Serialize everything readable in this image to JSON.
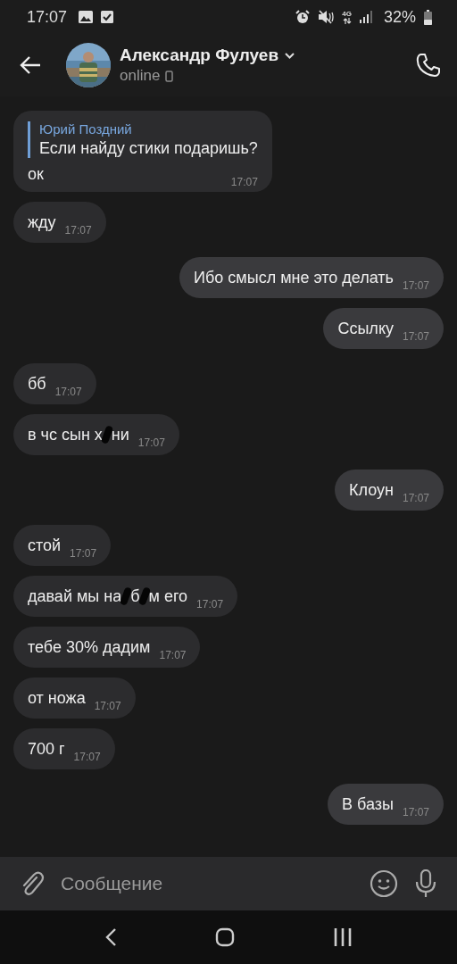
{
  "status_bar": {
    "time": "17:07",
    "network_type": "4G",
    "battery": "32%"
  },
  "header": {
    "name": "Александр Фулуев",
    "status": "online"
  },
  "messages": [
    {
      "outgoing": false,
      "reply": {
        "author": "Юрий Поздний",
        "text": "Если найду стики подаришь?"
      },
      "parts": [
        "ок"
      ],
      "time": "17:07"
    },
    {
      "outgoing": false,
      "parts": [
        "жду"
      ],
      "time": "17:07"
    },
    {
      "outgoing": true,
      "parts": [
        "Ибо смысл мне это делать"
      ],
      "time": "17:07"
    },
    {
      "outgoing": true,
      "parts": [
        "Ссылку"
      ],
      "time": "17:07"
    },
    {
      "outgoing": false,
      "parts": [
        "бб"
      ],
      "time": "17:07"
    },
    {
      "outgoing": false,
      "parts": [
        "в чс сын х",
        "ни"
      ],
      "time": "17:07"
    },
    {
      "outgoing": true,
      "parts": [
        "Клоун"
      ],
      "time": "17:07"
    },
    {
      "outgoing": false,
      "parts": [
        "стой"
      ],
      "time": "17:07"
    },
    {
      "outgoing": false,
      "parts": [
        "давай мы на",
        "б",
        "м его"
      ],
      "time": "17:07"
    },
    {
      "outgoing": false,
      "parts": [
        "тебе 30% дадим"
      ],
      "time": "17:07"
    },
    {
      "outgoing": false,
      "parts": [
        "от ножа"
      ],
      "time": "17:07"
    },
    {
      "outgoing": false,
      "parts": [
        "700 г"
      ],
      "time": "17:07"
    },
    {
      "outgoing": true,
      "parts": [
        "В базы"
      ],
      "time": "17:07"
    }
  ],
  "composer": {
    "placeholder": "Сообщение"
  }
}
